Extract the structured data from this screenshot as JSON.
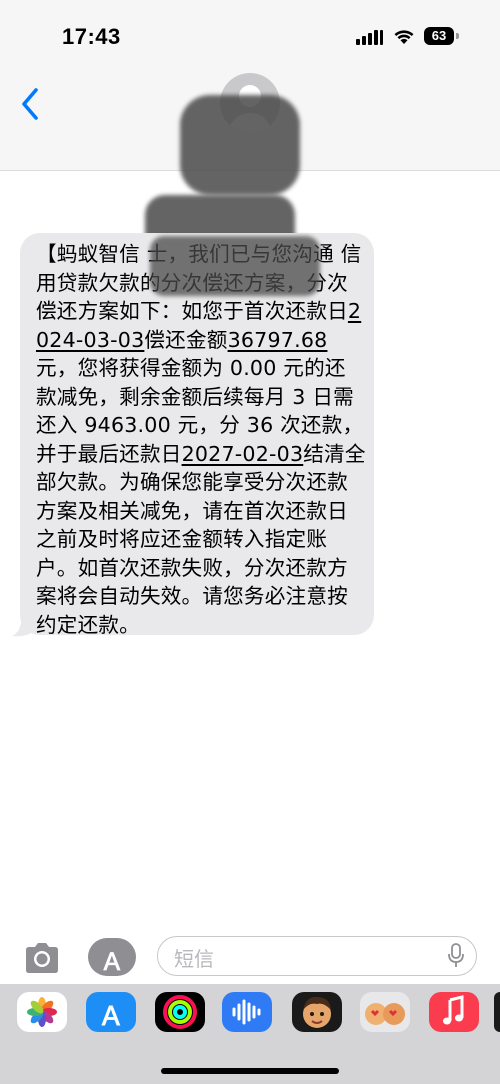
{
  "status_bar": {
    "time": "17:43",
    "battery": "63"
  },
  "conversation": {
    "back_icon": "chevron-left-icon",
    "contact_avatar": "person-icon"
  },
  "message": {
    "segments": [
      {
        "text": "【蚂蚁智信",
        "underline": false
      },
      {
        "text": "              ",
        "underline": false
      },
      {
        "text": "士，我们已与您沟通",
        "underline": false
      },
      {
        "text": "          ",
        "underline": false
      },
      {
        "text": "信用贷款欠款的分次偿还方案，分次偿还方案如下：如您于首次还款日",
        "underline": false
      },
      {
        "text": "2024-03-03",
        "underline": true
      },
      {
        "text": "偿还金额",
        "underline": false
      },
      {
        "text": "36797.68",
        "underline": true
      },
      {
        "text": "元，您将获得金额为 0.00 元的还款减免，剩余金额后续每月 3 日需还入 9463.00 元，分 36 次还款，并于最后还款日",
        "underline": false
      },
      {
        "text": "2027-02-03",
        "underline": true
      },
      {
        "text": "结清全部欠款。为确保您能享受分次还款方案及相关减免，请在首次还款日之前及时将应还金额转入指定账户。如首次还款失败，分次还款方案将会自动失效。请您务必注意按约定还款。",
        "underline": false
      }
    ]
  },
  "input_bar": {
    "placeholder": "短信",
    "camera_icon": "camera-icon",
    "apps_icon": "app-store-icon",
    "mic_icon": "microphone-icon"
  },
  "app_drawer": {
    "apps": [
      {
        "name": "photos-app-icon"
      },
      {
        "name": "app-store-app-icon"
      },
      {
        "name": "fitness-app-icon"
      },
      {
        "name": "audio-message-app-icon"
      },
      {
        "name": "memoji-app-icon"
      },
      {
        "name": "memoji-stickers-app-icon"
      },
      {
        "name": "music-app-icon"
      }
    ]
  },
  "colors": {
    "accent": "#007aff",
    "bubble": "#e9e9eb",
    "header_bg": "#f6f6f6",
    "drawer_bg": "#d4d4d7"
  }
}
